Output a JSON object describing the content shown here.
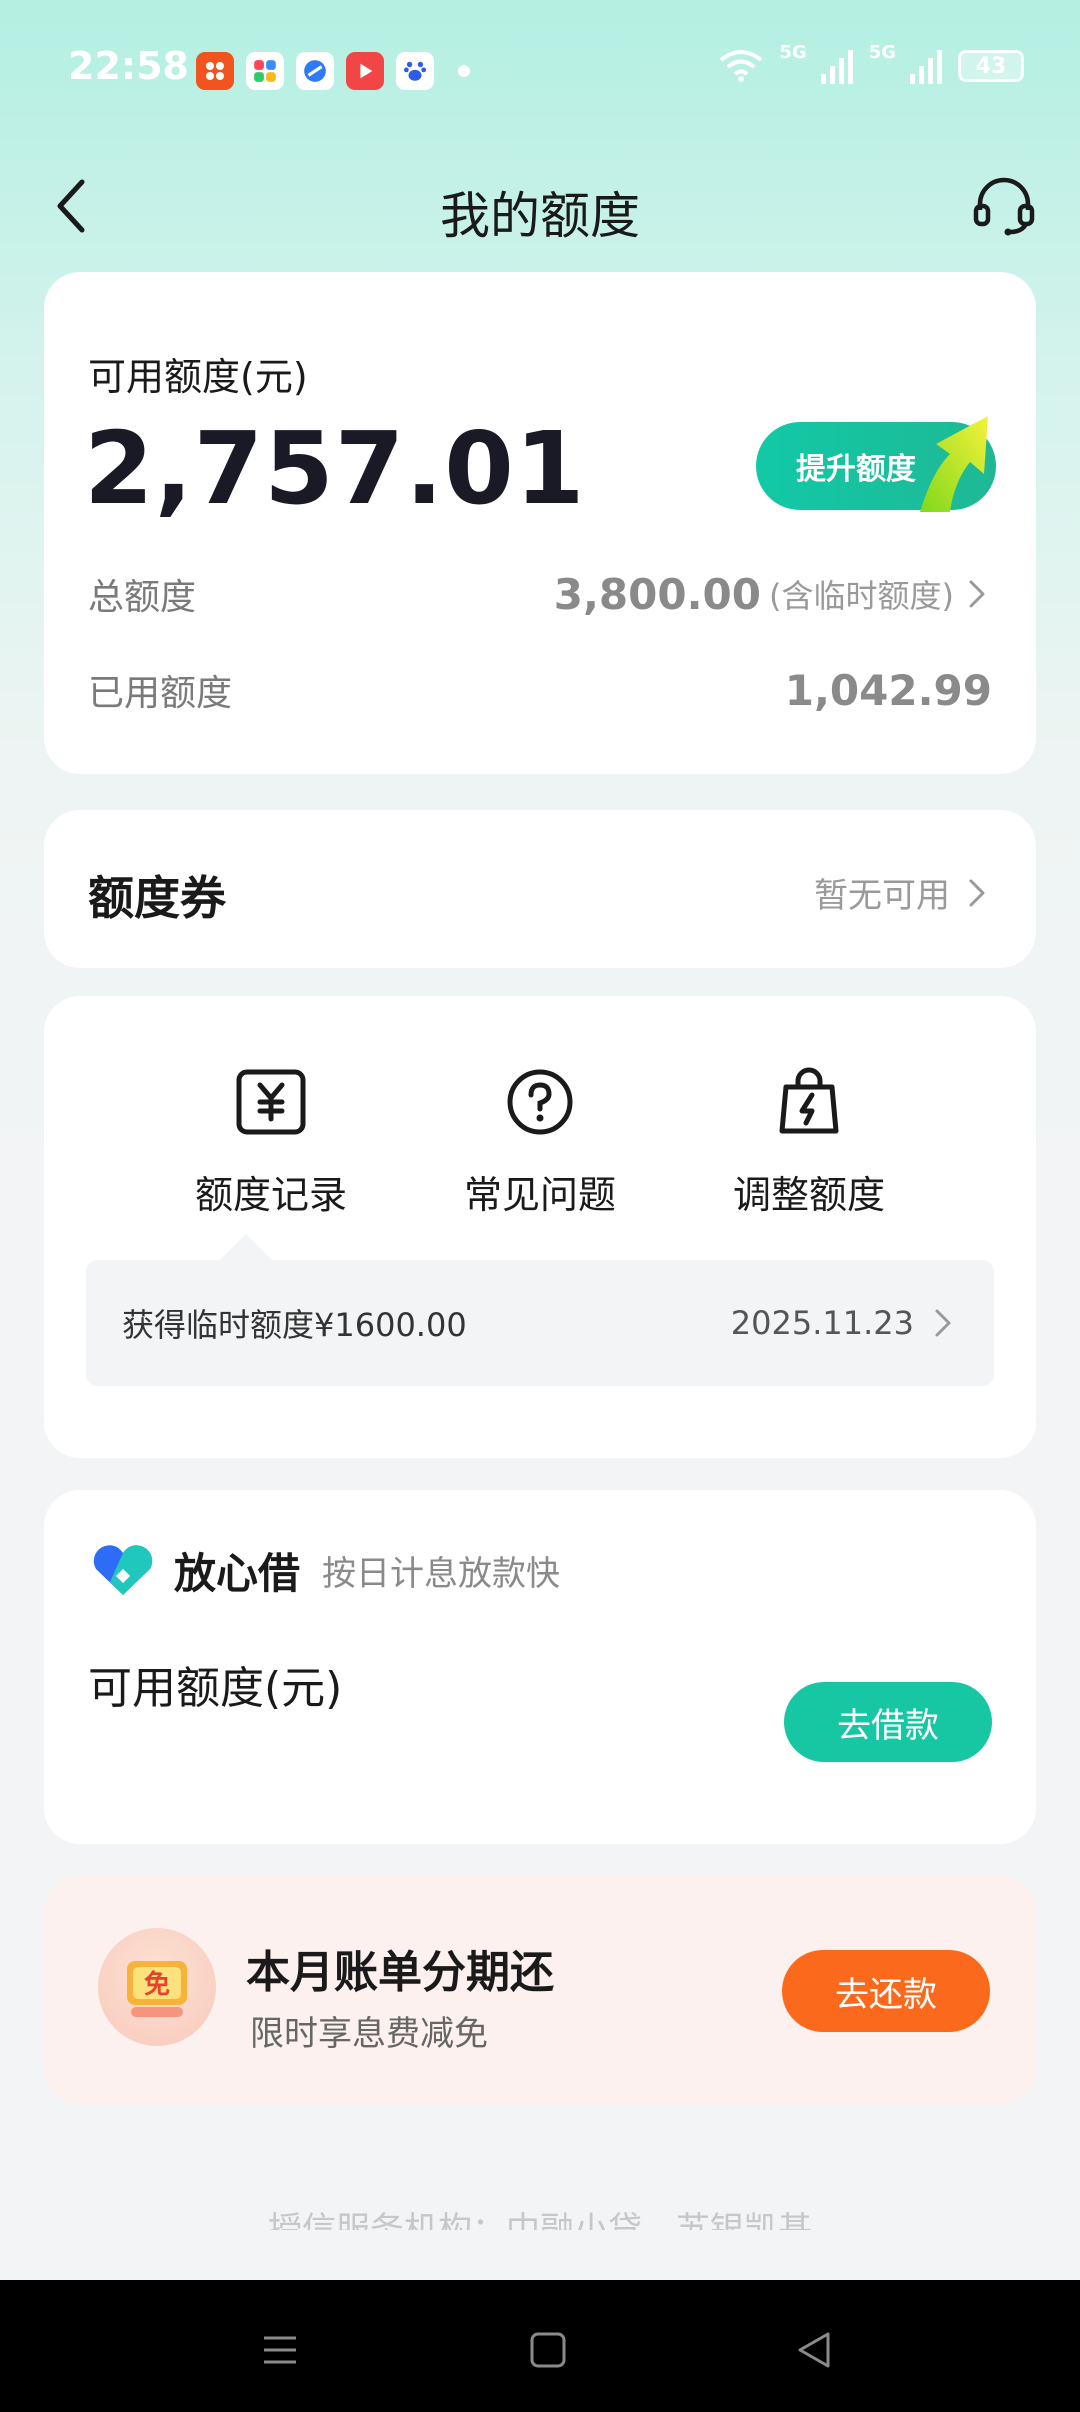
{
  "status_bar": {
    "time": "22:58",
    "network_1": "5G",
    "network_2": "5G",
    "battery": "43"
  },
  "header": {
    "title": "我的额度"
  },
  "quota": {
    "label": "可用额度(元)",
    "amount": "2,757.01",
    "raise_button": "提升额度",
    "total_label": "总额度",
    "total_value": "3,800.00",
    "total_note": "(含临时额度)",
    "used_label": "已用额度",
    "used_value": "1,042.99"
  },
  "coupon": {
    "title": "额度券",
    "status": "暂无可用"
  },
  "tools": {
    "items": [
      {
        "label": "额度记录",
        "icon": "yuan-receipt-icon"
      },
      {
        "label": "常见问题",
        "icon": "question-circle-icon"
      },
      {
        "label": "调整额度",
        "icon": "bag-lightning-icon"
      }
    ],
    "notice_text": "获得临时额度¥1600.00",
    "notice_date": "2025.11.23"
  },
  "loan": {
    "brand": "放心借",
    "slogan": "按日计息放款快",
    "label": "可用额度(元)",
    "button": "去借款"
  },
  "promo": {
    "badge_text": "免",
    "title": "本月账单分期还",
    "subtitle": "限时享息费减免",
    "button": "去还款"
  },
  "footer": {
    "text": "授信服务机构：中融小贷、苏银凯基"
  },
  "colors": {
    "accent": "#17c7a4",
    "orange": "#fb6a1c"
  }
}
